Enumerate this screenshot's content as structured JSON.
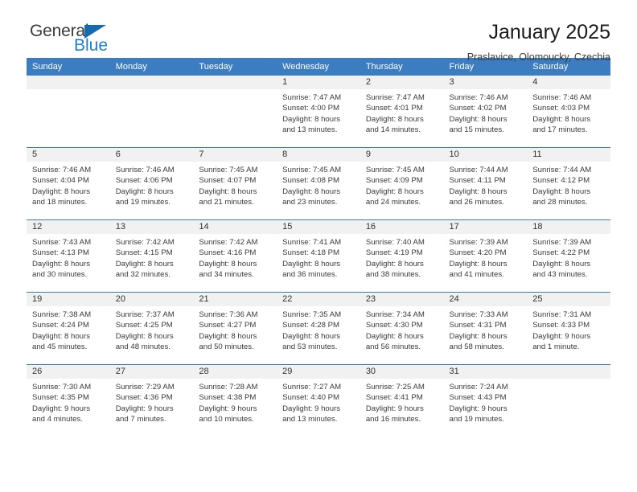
{
  "brand": {
    "name_dark": "General",
    "name_blue": "Blue",
    "accent_color": "#156bb1",
    "blue_text_color": "#1b7fd4"
  },
  "header": {
    "title": "January 2025",
    "subtitle": "Praslavice, Olomoucky, Czechia"
  },
  "calendar": {
    "header_bg": "#3b7dc0",
    "daynum_bg": "#f1f1f1",
    "weekday_headers": [
      "Sunday",
      "Monday",
      "Tuesday",
      "Wednesday",
      "Thursday",
      "Friday",
      "Saturday"
    ],
    "weeks": [
      [
        {
          "day": "",
          "empty": true
        },
        {
          "day": "",
          "empty": true
        },
        {
          "day": "",
          "empty": true
        },
        {
          "day": "1",
          "sunrise": "Sunrise: 7:47 AM",
          "sunset": "Sunset: 4:00 PM",
          "daylight_line1": "Daylight: 8 hours",
          "daylight_line2": "and 13 minutes."
        },
        {
          "day": "2",
          "sunrise": "Sunrise: 7:47 AM",
          "sunset": "Sunset: 4:01 PM",
          "daylight_line1": "Daylight: 8 hours",
          "daylight_line2": "and 14 minutes."
        },
        {
          "day": "3",
          "sunrise": "Sunrise: 7:46 AM",
          "sunset": "Sunset: 4:02 PM",
          "daylight_line1": "Daylight: 8 hours",
          "daylight_line2": "and 15 minutes."
        },
        {
          "day": "4",
          "sunrise": "Sunrise: 7:46 AM",
          "sunset": "Sunset: 4:03 PM",
          "daylight_line1": "Daylight: 8 hours",
          "daylight_line2": "and 17 minutes."
        }
      ],
      [
        {
          "day": "5",
          "sunrise": "Sunrise: 7:46 AM",
          "sunset": "Sunset: 4:04 PM",
          "daylight_line1": "Daylight: 8 hours",
          "daylight_line2": "and 18 minutes."
        },
        {
          "day": "6",
          "sunrise": "Sunrise: 7:46 AM",
          "sunset": "Sunset: 4:06 PM",
          "daylight_line1": "Daylight: 8 hours",
          "daylight_line2": "and 19 minutes."
        },
        {
          "day": "7",
          "sunrise": "Sunrise: 7:45 AM",
          "sunset": "Sunset: 4:07 PM",
          "daylight_line1": "Daylight: 8 hours",
          "daylight_line2": "and 21 minutes."
        },
        {
          "day": "8",
          "sunrise": "Sunrise: 7:45 AM",
          "sunset": "Sunset: 4:08 PM",
          "daylight_line1": "Daylight: 8 hours",
          "daylight_line2": "and 23 minutes."
        },
        {
          "day": "9",
          "sunrise": "Sunrise: 7:45 AM",
          "sunset": "Sunset: 4:09 PM",
          "daylight_line1": "Daylight: 8 hours",
          "daylight_line2": "and 24 minutes."
        },
        {
          "day": "10",
          "sunrise": "Sunrise: 7:44 AM",
          "sunset": "Sunset: 4:11 PM",
          "daylight_line1": "Daylight: 8 hours",
          "daylight_line2": "and 26 minutes."
        },
        {
          "day": "11",
          "sunrise": "Sunrise: 7:44 AM",
          "sunset": "Sunset: 4:12 PM",
          "daylight_line1": "Daylight: 8 hours",
          "daylight_line2": "and 28 minutes."
        }
      ],
      [
        {
          "day": "12",
          "sunrise": "Sunrise: 7:43 AM",
          "sunset": "Sunset: 4:13 PM",
          "daylight_line1": "Daylight: 8 hours",
          "daylight_line2": "and 30 minutes."
        },
        {
          "day": "13",
          "sunrise": "Sunrise: 7:42 AM",
          "sunset": "Sunset: 4:15 PM",
          "daylight_line1": "Daylight: 8 hours",
          "daylight_line2": "and 32 minutes."
        },
        {
          "day": "14",
          "sunrise": "Sunrise: 7:42 AM",
          "sunset": "Sunset: 4:16 PM",
          "daylight_line1": "Daylight: 8 hours",
          "daylight_line2": "and 34 minutes."
        },
        {
          "day": "15",
          "sunrise": "Sunrise: 7:41 AM",
          "sunset": "Sunset: 4:18 PM",
          "daylight_line1": "Daylight: 8 hours",
          "daylight_line2": "and 36 minutes."
        },
        {
          "day": "16",
          "sunrise": "Sunrise: 7:40 AM",
          "sunset": "Sunset: 4:19 PM",
          "daylight_line1": "Daylight: 8 hours",
          "daylight_line2": "and 38 minutes."
        },
        {
          "day": "17",
          "sunrise": "Sunrise: 7:39 AM",
          "sunset": "Sunset: 4:20 PM",
          "daylight_line1": "Daylight: 8 hours",
          "daylight_line2": "and 41 minutes."
        },
        {
          "day": "18",
          "sunrise": "Sunrise: 7:39 AM",
          "sunset": "Sunset: 4:22 PM",
          "daylight_line1": "Daylight: 8 hours",
          "daylight_line2": "and 43 minutes."
        }
      ],
      [
        {
          "day": "19",
          "sunrise": "Sunrise: 7:38 AM",
          "sunset": "Sunset: 4:24 PM",
          "daylight_line1": "Daylight: 8 hours",
          "daylight_line2": "and 45 minutes."
        },
        {
          "day": "20",
          "sunrise": "Sunrise: 7:37 AM",
          "sunset": "Sunset: 4:25 PM",
          "daylight_line1": "Daylight: 8 hours",
          "daylight_line2": "and 48 minutes."
        },
        {
          "day": "21",
          "sunrise": "Sunrise: 7:36 AM",
          "sunset": "Sunset: 4:27 PM",
          "daylight_line1": "Daylight: 8 hours",
          "daylight_line2": "and 50 minutes."
        },
        {
          "day": "22",
          "sunrise": "Sunrise: 7:35 AM",
          "sunset": "Sunset: 4:28 PM",
          "daylight_line1": "Daylight: 8 hours",
          "daylight_line2": "and 53 minutes."
        },
        {
          "day": "23",
          "sunrise": "Sunrise: 7:34 AM",
          "sunset": "Sunset: 4:30 PM",
          "daylight_line1": "Daylight: 8 hours",
          "daylight_line2": "and 56 minutes."
        },
        {
          "day": "24",
          "sunrise": "Sunrise: 7:33 AM",
          "sunset": "Sunset: 4:31 PM",
          "daylight_line1": "Daylight: 8 hours",
          "daylight_line2": "and 58 minutes."
        },
        {
          "day": "25",
          "sunrise": "Sunrise: 7:31 AM",
          "sunset": "Sunset: 4:33 PM",
          "daylight_line1": "Daylight: 9 hours",
          "daylight_line2": "and 1 minute."
        }
      ],
      [
        {
          "day": "26",
          "sunrise": "Sunrise: 7:30 AM",
          "sunset": "Sunset: 4:35 PM",
          "daylight_line1": "Daylight: 9 hours",
          "daylight_line2": "and 4 minutes."
        },
        {
          "day": "27",
          "sunrise": "Sunrise: 7:29 AM",
          "sunset": "Sunset: 4:36 PM",
          "daylight_line1": "Daylight: 9 hours",
          "daylight_line2": "and 7 minutes."
        },
        {
          "day": "28",
          "sunrise": "Sunrise: 7:28 AM",
          "sunset": "Sunset: 4:38 PM",
          "daylight_line1": "Daylight: 9 hours",
          "daylight_line2": "and 10 minutes."
        },
        {
          "day": "29",
          "sunrise": "Sunrise: 7:27 AM",
          "sunset": "Sunset: 4:40 PM",
          "daylight_line1": "Daylight: 9 hours",
          "daylight_line2": "and 13 minutes."
        },
        {
          "day": "30",
          "sunrise": "Sunrise: 7:25 AM",
          "sunset": "Sunset: 4:41 PM",
          "daylight_line1": "Daylight: 9 hours",
          "daylight_line2": "and 16 minutes."
        },
        {
          "day": "31",
          "sunrise": "Sunrise: 7:24 AM",
          "sunset": "Sunset: 4:43 PM",
          "daylight_line1": "Daylight: 9 hours",
          "daylight_line2": "and 19 minutes."
        },
        {
          "day": "",
          "empty": true
        }
      ]
    ]
  }
}
